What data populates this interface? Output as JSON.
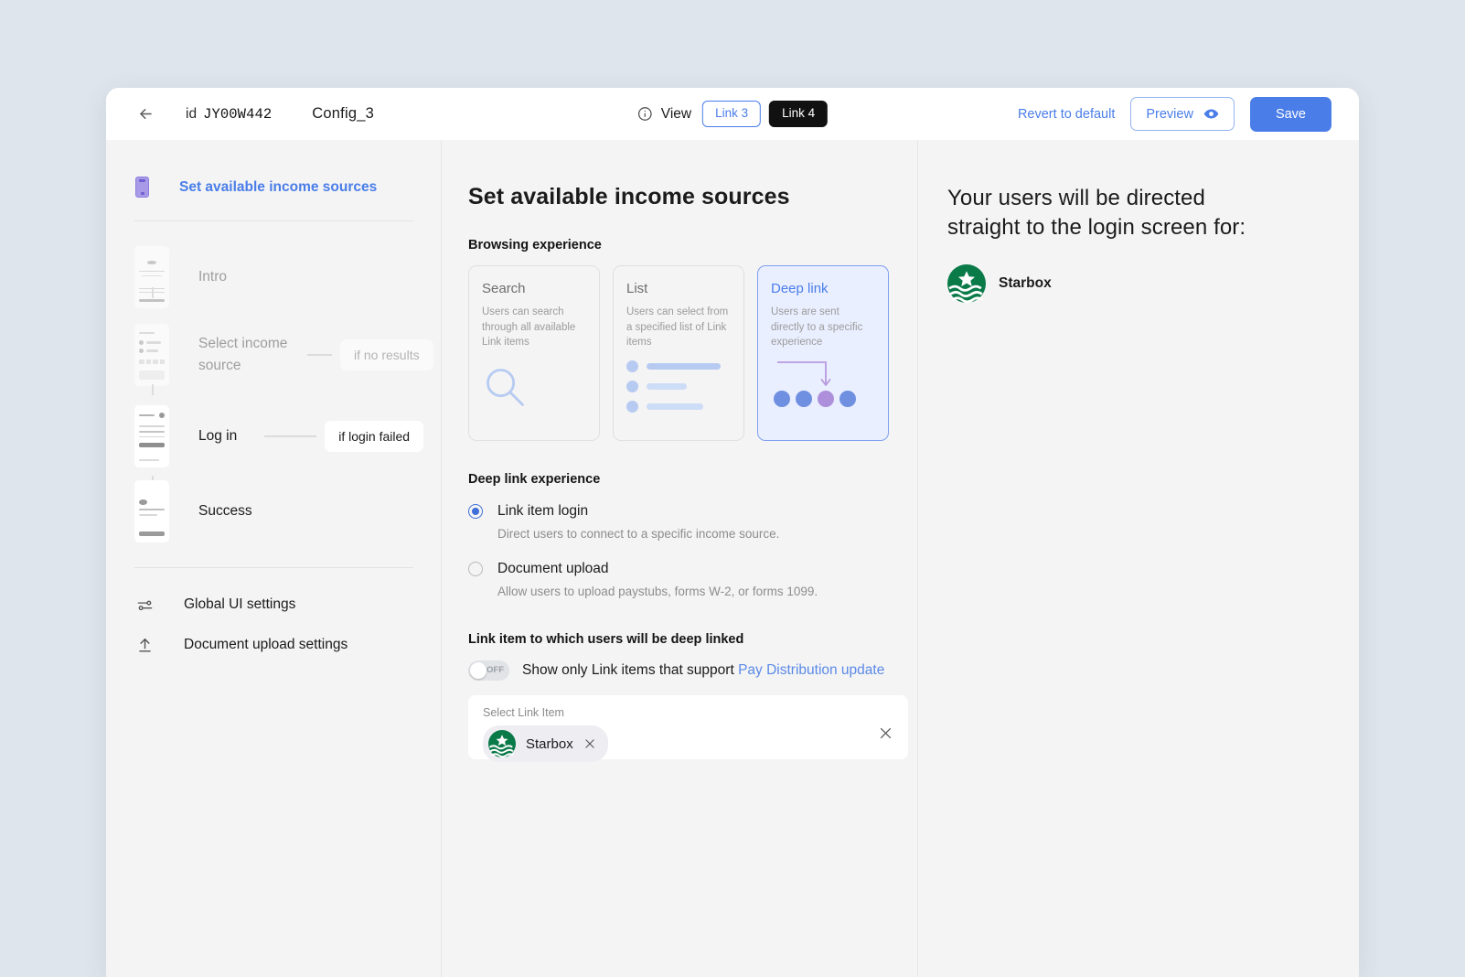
{
  "header": {
    "back_icon": "arrow-left-icon",
    "id_label": "id",
    "id_value": "JY00W442",
    "config_name": "Config_3",
    "info_icon": "info-circle-icon",
    "view_label": "View",
    "tab_link3": "Link 3",
    "tab_link4": "Link 4",
    "revert_label": "Revert to default",
    "preview_label": "Preview",
    "preview_icon": "eye-icon",
    "save_label": "Save"
  },
  "sidebar": {
    "flow_header": "Set available income sources",
    "flow_icon": "mobile-phone-icon",
    "steps": [
      {
        "label": "Intro",
        "state": "dim",
        "branch": null
      },
      {
        "label": "Select income source",
        "state": "dim",
        "branch": "if no results",
        "branch_state": "dim"
      },
      {
        "label": "Log in",
        "state": "lit",
        "branch": "if login failed",
        "branch_state": "lit"
      },
      {
        "label": "Success",
        "state": "lit",
        "branch": null
      }
    ],
    "settings": [
      {
        "label": "Global UI settings",
        "icon": "sliders-icon"
      },
      {
        "label": "Document upload settings",
        "icon": "upload-icon"
      }
    ]
  },
  "main": {
    "title": "Set available income sources",
    "browsing_label": "Browsing experience",
    "cards": [
      {
        "title": "Search",
        "desc": "Users can search through all available Link items",
        "art": "magnifier-icon",
        "selected": false
      },
      {
        "title": "List",
        "desc": "Users can select from a specified list of Link items",
        "art": "list-icon",
        "selected": false
      },
      {
        "title": "Deep link",
        "desc": "Users are sent directly to a specific experience",
        "art": "deeplink-arrow-dots-icon",
        "selected": true
      }
    ],
    "deeplink_label": "Deep link experience",
    "options": [
      {
        "label": "Link item login",
        "help": "Direct users to connect to a specific income source.",
        "selected": true
      },
      {
        "label": "Document upload",
        "help": "Allow users to upload paystubs, forms W-2, or forms 1099.",
        "selected": false
      }
    ],
    "link_item_label": "Link item to which users will be deep linked",
    "toggle_state": "OFF",
    "toggle_text": "Show only Link items that support ",
    "toggle_link_text": "Pay Distribution update",
    "select_caption": "Select Link Item",
    "selected_token": "Starbox",
    "token_remove_icon": "close-icon",
    "box_clear_icon": "close-icon"
  },
  "right": {
    "title": "Your users will be directed straight to the login screen for:",
    "brand_name": "Starbox",
    "brand_icon": "starbox-logo",
    "brand_color": "#0a7a49"
  },
  "colors": {
    "accent_blue": "#4a7de8",
    "selected_card_bg": "#eaefff",
    "page_bg": "#dfe5ec",
    "panel_bg": "#f4f4f4"
  }
}
